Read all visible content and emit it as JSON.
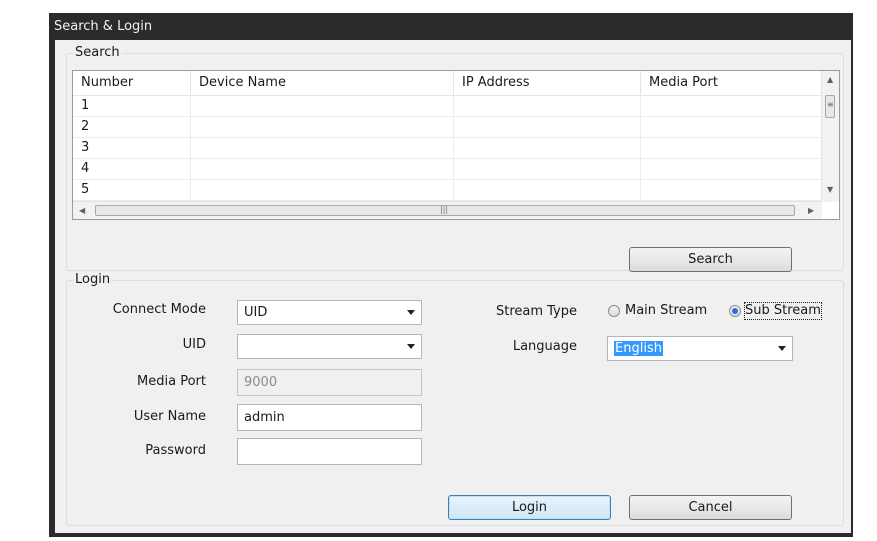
{
  "window": {
    "title": "Search & Login"
  },
  "search": {
    "group_title": "Search",
    "columns": [
      "Number",
      "Device Name",
      "IP Address",
      "Media Port"
    ],
    "rows": [
      [
        "1",
        "",
        "",
        ""
      ],
      [
        "2",
        "",
        "",
        ""
      ],
      [
        "3",
        "",
        "",
        ""
      ],
      [
        "4",
        "",
        "",
        ""
      ],
      [
        "5",
        "",
        "",
        ""
      ]
    ],
    "search_button": "Search"
  },
  "login": {
    "group_title": "Login",
    "connect_mode_label": "Connect Mode",
    "connect_mode_value": "UID",
    "uid_label": "UID",
    "uid_value": "",
    "media_port_label": "Media Port",
    "media_port_value": "9000",
    "user_name_label": "User Name",
    "user_name_value": "admin",
    "password_label": "Password",
    "password_value": "",
    "stream_type_label": "Stream Type",
    "stream_options": [
      {
        "label": "Main Stream",
        "checked": false
      },
      {
        "label": "Sub Stream",
        "checked": true
      }
    ],
    "language_label": "Language",
    "language_value": "English",
    "login_button": "Login",
    "cancel_button": "Cancel"
  },
  "icons": {
    "scroll_up": "scroll-up-arrow-icon",
    "scroll_down": "scroll-down-arrow-icon",
    "scroll_left": "scroll-left-arrow-icon",
    "scroll_right": "scroll-right-arrow-icon",
    "dropdown": "chevron-down-icon"
  },
  "colors": {
    "titlebar": "#2b2b2b",
    "selection": "#3399ff",
    "default_button": "#3c7fb1"
  }
}
